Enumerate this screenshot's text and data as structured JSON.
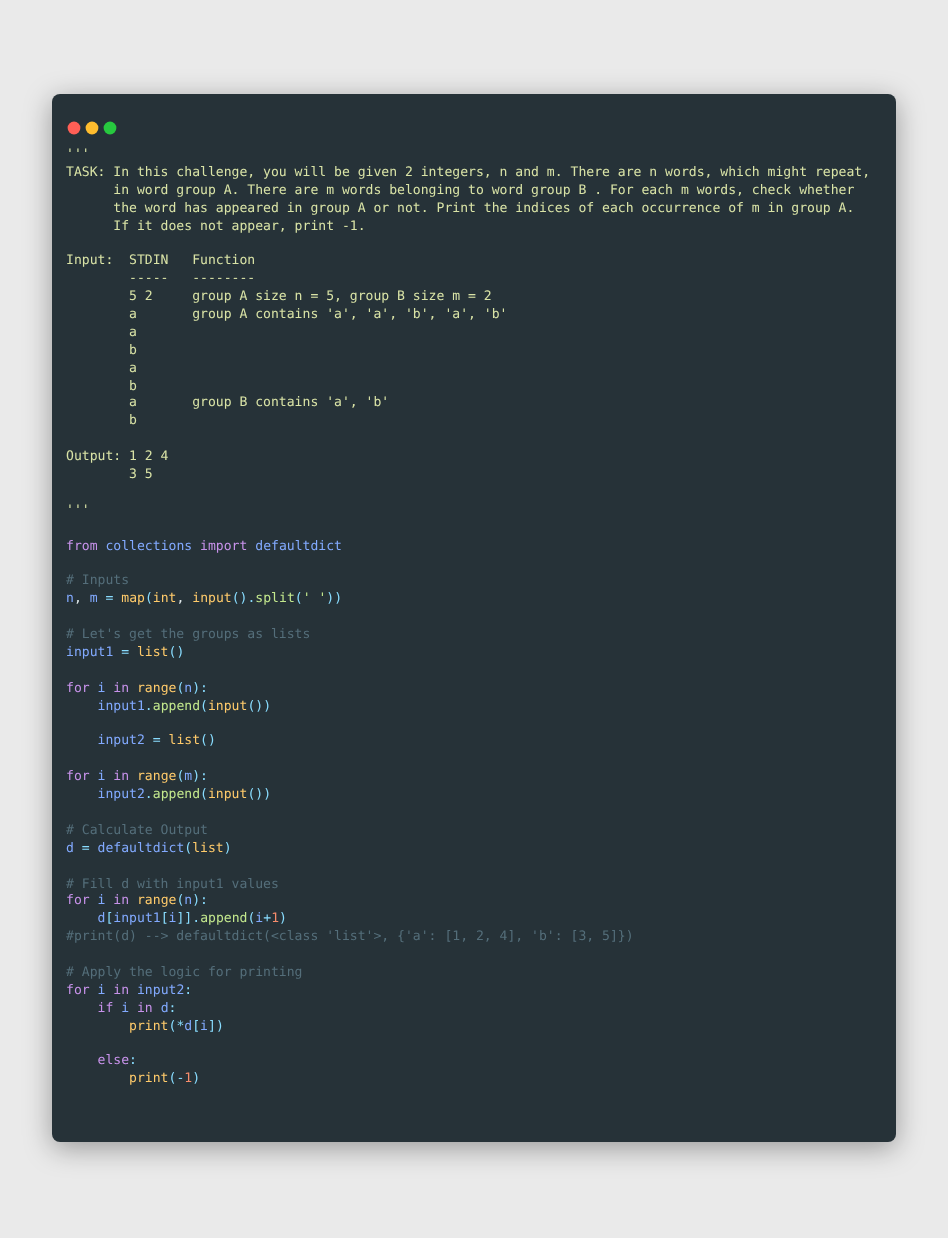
{
  "code_lines": [
    {
      "kind": "code",
      "tokens": [
        {
          "text": "'''",
          "kind": "doc"
        }
      ]
    },
    {
      "kind": "code",
      "tokens": [
        {
          "text": "TASK: In this challenge, you will be given 2 integers, n and m. There are n words, which might repeat,",
          "kind": "doc"
        }
      ]
    },
    {
      "kind": "code",
      "tokens": [
        {
          "text": "      in word group A. There are m words belonging to word group B . For each m words, check whether",
          "kind": "doc"
        }
      ]
    },
    {
      "kind": "code",
      "tokens": [
        {
          "text": "      the word has appeared in group A or not. Print the indices of each occurrence of m in group A.",
          "kind": "doc"
        }
      ]
    },
    {
      "kind": "code",
      "tokens": [
        {
          "text": "      If it does not appear, print -1.",
          "kind": "doc"
        }
      ]
    },
    {
      "kind": "blank"
    },
    {
      "kind": "code",
      "tokens": [
        {
          "text": "Input:  STDIN   Function",
          "kind": "doc"
        }
      ]
    },
    {
      "kind": "code",
      "tokens": [
        {
          "text": "        -----   --------",
          "kind": "doc"
        }
      ]
    },
    {
      "kind": "code",
      "tokens": [
        {
          "text": "        5 2     group A size n = 5, group B size m = 2",
          "kind": "doc"
        }
      ]
    },
    {
      "kind": "code",
      "tokens": [
        {
          "text": "        a       group A contains 'a', 'a', 'b', 'a', 'b'",
          "kind": "doc"
        }
      ]
    },
    {
      "kind": "code",
      "tokens": [
        {
          "text": "        a",
          "kind": "doc"
        }
      ]
    },
    {
      "kind": "code",
      "tokens": [
        {
          "text": "        b",
          "kind": "doc"
        }
      ]
    },
    {
      "kind": "code",
      "tokens": [
        {
          "text": "        a",
          "kind": "doc"
        }
      ]
    },
    {
      "kind": "code",
      "tokens": [
        {
          "text": "        b",
          "kind": "doc"
        }
      ]
    },
    {
      "kind": "code",
      "tokens": [
        {
          "text": "        a       group B contains 'a', 'b'",
          "kind": "doc"
        }
      ]
    },
    {
      "kind": "code",
      "tokens": [
        {
          "text": "        b",
          "kind": "doc"
        }
      ]
    },
    {
      "kind": "blank"
    },
    {
      "kind": "code",
      "tokens": [
        {
          "text": "Output: 1 2 4",
          "kind": "doc"
        }
      ]
    },
    {
      "kind": "code",
      "tokens": [
        {
          "text": "        3 5",
          "kind": "doc"
        }
      ]
    },
    {
      "kind": "blank"
    },
    {
      "kind": "code",
      "tokens": [
        {
          "text": "'''",
          "kind": "doc"
        }
      ]
    },
    {
      "kind": "blank"
    },
    {
      "kind": "code",
      "tokens": [
        {
          "text": "from",
          "kind": "kw"
        },
        {
          "text": " collections ",
          "kind": "var"
        },
        {
          "text": "import",
          "kind": "kw"
        },
        {
          "text": " defaultdict",
          "kind": "var"
        }
      ]
    },
    {
      "kind": "blank"
    },
    {
      "kind": "code",
      "tokens": [
        {
          "text": "# Inputs",
          "kind": "cm"
        }
      ]
    },
    {
      "kind": "code",
      "tokens": [
        {
          "text": "n",
          "kind": "var"
        },
        {
          "text": ", ",
          "kind": "plain"
        },
        {
          "text": "m",
          "kind": "var"
        },
        {
          "text": " = ",
          "kind": "op"
        },
        {
          "text": "map",
          "kind": "fn"
        },
        {
          "text": "(",
          "kind": "op"
        },
        {
          "text": "int",
          "kind": "fn"
        },
        {
          "text": ", ",
          "kind": "plain"
        },
        {
          "text": "input",
          "kind": "fn"
        },
        {
          "text": "().",
          "kind": "op"
        },
        {
          "text": "split",
          "kind": "meth"
        },
        {
          "text": "(",
          "kind": "op"
        },
        {
          "text": "' '",
          "kind": "str"
        },
        {
          "text": "))",
          "kind": "op"
        }
      ]
    },
    {
      "kind": "blank"
    },
    {
      "kind": "code",
      "tokens": [
        {
          "text": "# Let's get the groups as lists",
          "kind": "cm"
        }
      ]
    },
    {
      "kind": "code",
      "tokens": [
        {
          "text": "input1",
          "kind": "var"
        },
        {
          "text": " = ",
          "kind": "op"
        },
        {
          "text": "list",
          "kind": "fn"
        },
        {
          "text": "()",
          "kind": "op"
        }
      ]
    },
    {
      "kind": "blank"
    },
    {
      "kind": "code",
      "tokens": [
        {
          "text": "for",
          "kind": "kw"
        },
        {
          "text": " i ",
          "kind": "var"
        },
        {
          "text": "in",
          "kind": "kw"
        },
        {
          "text": " range",
          "kind": "fn"
        },
        {
          "text": "(",
          "kind": "op"
        },
        {
          "text": "n",
          "kind": "var"
        },
        {
          "text": "):",
          "kind": "op"
        }
      ]
    },
    {
      "kind": "code",
      "tokens": [
        {
          "text": "    input1",
          "kind": "var"
        },
        {
          "text": ".",
          "kind": "op"
        },
        {
          "text": "append",
          "kind": "meth"
        },
        {
          "text": "(",
          "kind": "op"
        },
        {
          "text": "input",
          "kind": "fn"
        },
        {
          "text": "())",
          "kind": "op"
        }
      ]
    },
    {
      "kind": "blank"
    },
    {
      "kind": "code",
      "tokens": [
        {
          "text": "    input2",
          "kind": "var"
        },
        {
          "text": " = ",
          "kind": "op"
        },
        {
          "text": "list",
          "kind": "fn"
        },
        {
          "text": "()",
          "kind": "op"
        }
      ]
    },
    {
      "kind": "blank"
    },
    {
      "kind": "code",
      "tokens": [
        {
          "text": "for",
          "kind": "kw"
        },
        {
          "text": " i ",
          "kind": "var"
        },
        {
          "text": "in",
          "kind": "kw"
        },
        {
          "text": " range",
          "kind": "fn"
        },
        {
          "text": "(",
          "kind": "op"
        },
        {
          "text": "m",
          "kind": "var"
        },
        {
          "text": "):",
          "kind": "op"
        }
      ]
    },
    {
      "kind": "code",
      "tokens": [
        {
          "text": "    input2",
          "kind": "var"
        },
        {
          "text": ".",
          "kind": "op"
        },
        {
          "text": "append",
          "kind": "meth"
        },
        {
          "text": "(",
          "kind": "op"
        },
        {
          "text": "input",
          "kind": "fn"
        },
        {
          "text": "())",
          "kind": "op"
        }
      ]
    },
    {
      "kind": "blank"
    },
    {
      "kind": "code",
      "tokens": [
        {
          "text": "# Calculate Output",
          "kind": "cm"
        }
      ]
    },
    {
      "kind": "code",
      "tokens": [
        {
          "text": "d",
          "kind": "var"
        },
        {
          "text": " = ",
          "kind": "op"
        },
        {
          "text": "defaultdict",
          "kind": "var"
        },
        {
          "text": "(",
          "kind": "op"
        },
        {
          "text": "list",
          "kind": "fn"
        },
        {
          "text": ")",
          "kind": "op"
        }
      ]
    },
    {
      "kind": "blank"
    },
    {
      "kind": "code",
      "tokens": [
        {
          "text": "# Fill d with input1 values",
          "kind": "cm"
        }
      ]
    },
    {
      "kind": "code",
      "tokens": [
        {
          "text": "for",
          "kind": "kw"
        },
        {
          "text": " i ",
          "kind": "var"
        },
        {
          "text": "in",
          "kind": "kw"
        },
        {
          "text": " range",
          "kind": "fn"
        },
        {
          "text": "(",
          "kind": "op"
        },
        {
          "text": "n",
          "kind": "var"
        },
        {
          "text": "):",
          "kind": "op"
        }
      ]
    },
    {
      "kind": "code",
      "tokens": [
        {
          "text": "    d",
          "kind": "var"
        },
        {
          "text": "[",
          "kind": "op"
        },
        {
          "text": "input1",
          "kind": "var"
        },
        {
          "text": "[",
          "kind": "op"
        },
        {
          "text": "i",
          "kind": "var"
        },
        {
          "text": "]].",
          "kind": "op"
        },
        {
          "text": "append",
          "kind": "meth"
        },
        {
          "text": "(",
          "kind": "op"
        },
        {
          "text": "i",
          "kind": "var"
        },
        {
          "text": "+",
          "kind": "op"
        },
        {
          "text": "1",
          "kind": "num"
        },
        {
          "text": ")",
          "kind": "op"
        }
      ]
    },
    {
      "kind": "code",
      "tokens": [
        {
          "text": "#print(d) --> defaultdict(<class 'list'>, {'a': [1, 2, 4], 'b': [3, 5]})",
          "kind": "cm"
        }
      ]
    },
    {
      "kind": "blank"
    },
    {
      "kind": "code",
      "tokens": [
        {
          "text": "# Apply the logic for printing",
          "kind": "cm"
        }
      ]
    },
    {
      "kind": "code",
      "tokens": [
        {
          "text": "for",
          "kind": "kw"
        },
        {
          "text": " i ",
          "kind": "var"
        },
        {
          "text": "in",
          "kind": "kw"
        },
        {
          "text": " input2",
          "kind": "var"
        },
        {
          "text": ":",
          "kind": "op"
        }
      ]
    },
    {
      "kind": "code",
      "tokens": [
        {
          "text": "    if",
          "kind": "kw"
        },
        {
          "text": " i ",
          "kind": "var"
        },
        {
          "text": "in",
          "kind": "kw"
        },
        {
          "text": " d",
          "kind": "var"
        },
        {
          "text": ":",
          "kind": "op"
        }
      ]
    },
    {
      "kind": "code",
      "tokens": [
        {
          "text": "        print",
          "kind": "fn"
        },
        {
          "text": "(*",
          "kind": "op"
        },
        {
          "text": "d",
          "kind": "var"
        },
        {
          "text": "[",
          "kind": "op"
        },
        {
          "text": "i",
          "kind": "var"
        },
        {
          "text": "])",
          "kind": "op"
        }
      ]
    },
    {
      "kind": "blank"
    },
    {
      "kind": "code",
      "tokens": [
        {
          "text": "    else",
          "kind": "kw"
        },
        {
          "text": ":",
          "kind": "op"
        }
      ]
    },
    {
      "kind": "code",
      "tokens": [
        {
          "text": "        print",
          "kind": "fn"
        },
        {
          "text": "(-",
          "kind": "op"
        },
        {
          "text": "1",
          "kind": "num"
        },
        {
          "text": ")",
          "kind": "op"
        }
      ]
    }
  ]
}
